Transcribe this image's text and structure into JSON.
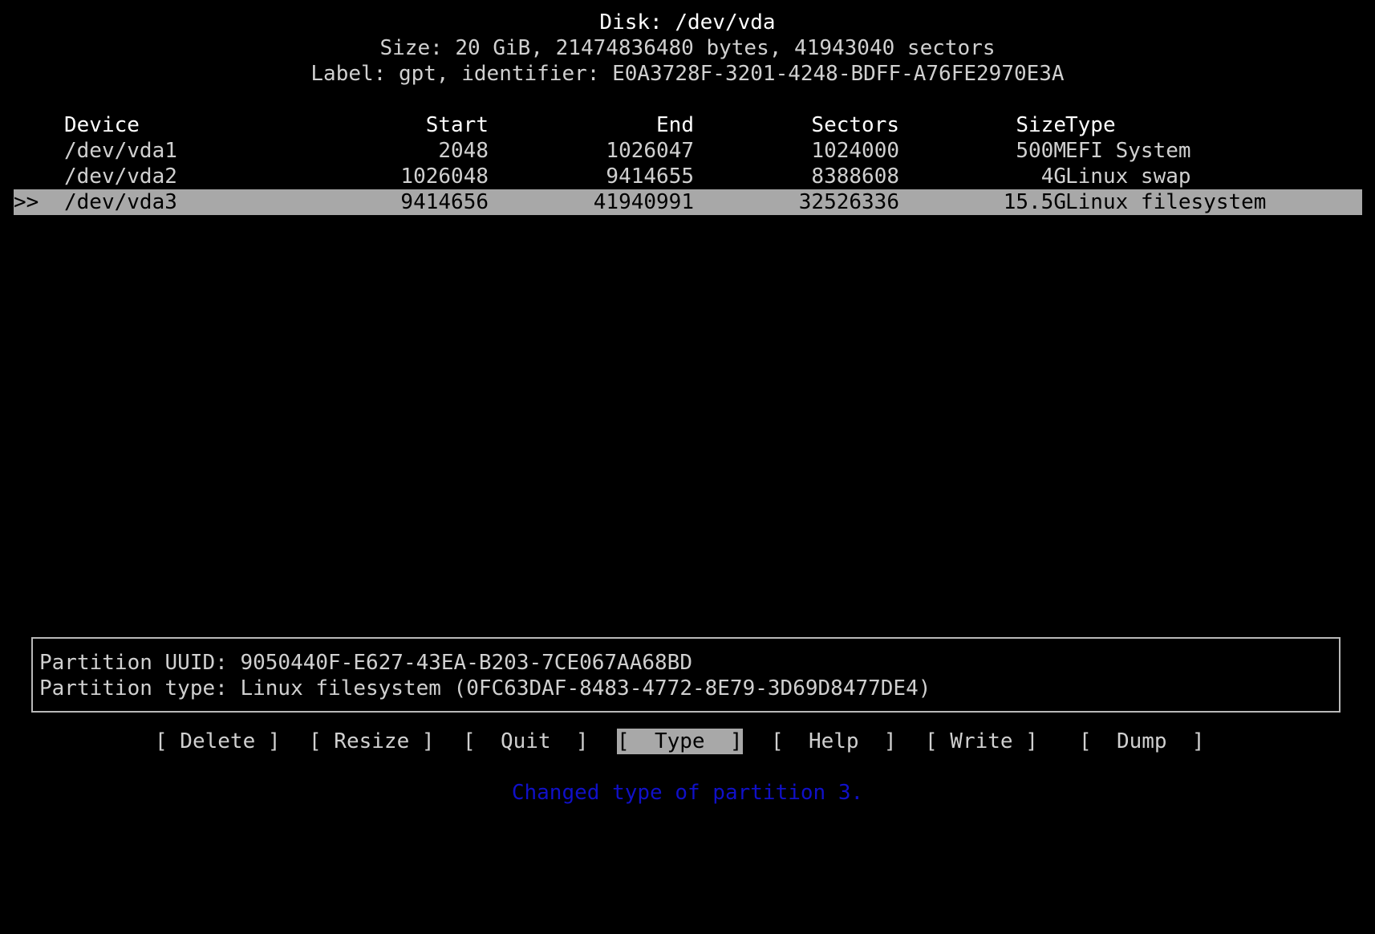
{
  "disk": {
    "title": "Disk: /dev/vda",
    "size_line": "Size: 20 GiB, 21474836480 bytes, 41943040 sectors",
    "label_line": "Label: gpt, identifier: E0A3728F-3201-4248-BDFF-A76FE2970E3A"
  },
  "table": {
    "headers": {
      "device": "Device",
      "start": "Start",
      "end": "End",
      "sectors": "Sectors",
      "size": "Size",
      "type": "Type"
    },
    "rows": [
      {
        "cursor": "",
        "device": "/dev/vda1",
        "start": "2048",
        "end": "1026047",
        "sectors": "1024000",
        "size": "500M",
        "type": "EFI System"
      },
      {
        "cursor": "",
        "device": "/dev/vda2",
        "start": "1026048",
        "end": "9414655",
        "sectors": "8388608",
        "size": "4G",
        "type": "Linux swap"
      },
      {
        "cursor": ">>",
        "device": "/dev/vda3",
        "start": "9414656",
        "end": "41940991",
        "sectors": "32526336",
        "size": "15.5G",
        "type": "Linux filesystem"
      }
    ],
    "selected_index": 2
  },
  "info": {
    "uuid_line": "Partition UUID: 9050440F-E627-43EA-B203-7CE067AA68BD",
    "type_line": "Partition type: Linux filesystem (0FC63DAF-8483-4772-8E79-3D69D8477DE4)"
  },
  "menu": {
    "delete": "[ Delete ]",
    "resize": "[ Resize ]",
    "quit": "[  Quit  ]",
    "type": "[  Type  ]",
    "help": "[  Help  ]",
    "write": "[ Write ]",
    "dump": "[  Dump  ]",
    "active": "type"
  },
  "status": "Changed type of partition 3.",
  "colors": {
    "background": "#000000",
    "text": "#d0d0d0",
    "highlight": "#a8a8a8",
    "status": "#1010c8"
  }
}
